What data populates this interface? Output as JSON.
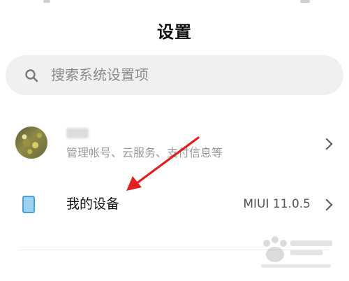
{
  "page": {
    "title": "设置"
  },
  "search": {
    "placeholder": "搜索系统设置项",
    "icon": "search-icon"
  },
  "account": {
    "name": "",
    "subtitle": "管理帐号、云服务、支付信息等",
    "avatar_icon": "avatar",
    "chevron_icon": "chevron-right-icon"
  },
  "device": {
    "label": "我的设备",
    "version": "MIUI 11.0.5",
    "icon": "phone-icon",
    "chevron_icon": "chevron-right-icon"
  },
  "annotation": {
    "arrow_color": "#e02020"
  },
  "colors": {
    "accent": "#4a9fd8",
    "search_bg": "#f0f0f0"
  }
}
